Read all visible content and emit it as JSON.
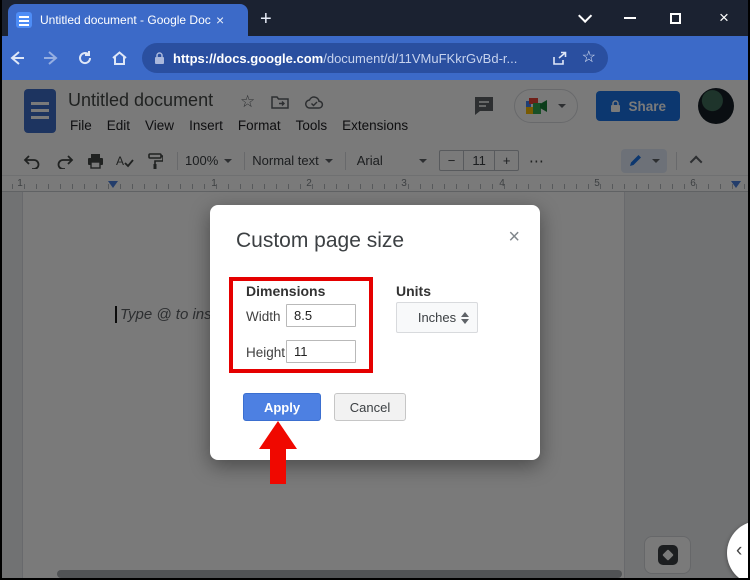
{
  "colors": {
    "chrome_blue": "#3c6ac8",
    "titlebar_dark": "#1b2231",
    "omnibox_blue": "#2a4fa0",
    "share_blue": "#1a73e8",
    "apply_blue": "#4d80e2",
    "annotation_red": "#e50000"
  },
  "browser": {
    "tab_title": "Untitled document - Google Doc",
    "tab_close_glyph": "×",
    "new_tab_glyph": "+",
    "window_close_glyph": "×",
    "url_scheme_host": "https://docs.google.com",
    "url_path": "/document/d/11VMuFKkrGvBd-r...",
    "star_glyph": "☆"
  },
  "docs": {
    "header": {
      "title": "Untitled document",
      "star_glyph": "☆",
      "menus": [
        "File",
        "Edit",
        "View",
        "Insert",
        "Format",
        "Tools",
        "Extensions"
      ],
      "share_label": "Share"
    },
    "toolbar": {
      "zoom": "100%",
      "paragraph_style": "Normal text",
      "font": "Arial",
      "minus": "−",
      "font_size": "11",
      "plus": "+",
      "more": "⋯"
    },
    "ruler": {
      "marks": [
        {
          "label": "1"
        },
        {
          "label": "1"
        },
        {
          "label": "2"
        },
        {
          "label": "3"
        },
        {
          "label": "4"
        },
        {
          "label": "5"
        },
        {
          "label": "6"
        }
      ]
    },
    "document": {
      "placeholder": "Type @ to ins"
    },
    "side_panel_chevron": "‹"
  },
  "dialog": {
    "title": "Custom page size",
    "close_glyph": "×",
    "dimensions_label": "Dimensions",
    "width_label": "Width",
    "width_value": "8.5",
    "height_label": "Height",
    "height_value": "11",
    "units_label": "Units",
    "units_value": "Inches",
    "apply_label": "Apply",
    "cancel_label": "Cancel"
  }
}
